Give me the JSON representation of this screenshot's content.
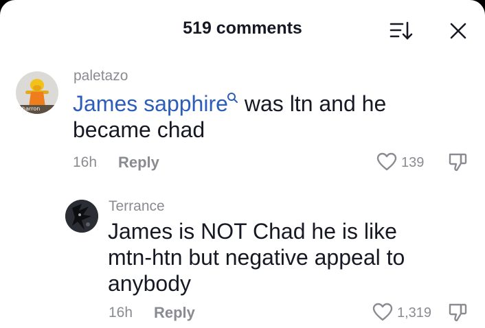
{
  "header": {
    "title": "519 comments"
  },
  "comments": [
    {
      "username": "paletazo",
      "avatar_label": "sharron",
      "mention": "James sapphire",
      "text_after_mention": "was ltn and he",
      "text_line2": "became chad",
      "time": "16h",
      "reply_label": "Reply",
      "likes": "139"
    },
    {
      "username": "Terrance",
      "text_line1": "James is NOT Chad he is like",
      "text_line2": "mtn-htn but negative appeal to",
      "text_line3": "anybody",
      "time": "16h",
      "reply_label": "Reply",
      "likes": "1,319"
    }
  ],
  "colors": {
    "mention": "#2b5db9",
    "text": "#161823",
    "muted": "#8a8b91"
  }
}
